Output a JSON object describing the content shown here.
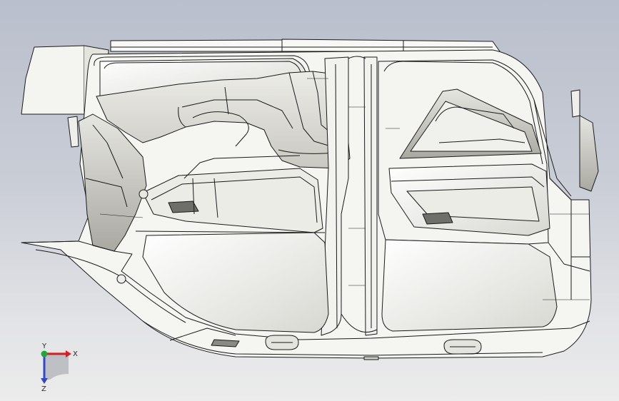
{
  "viewport": {
    "background_top": "#b9bfcc",
    "background_bottom": "#ececec"
  },
  "model": {
    "fill_light": "#f7f7f4",
    "fill_shade": "#dcdcd6",
    "fill_dark": "#b5b5ae",
    "edge_color": "#1a1a1a"
  },
  "triad": {
    "x_label": "X",
    "y_label": "Y",
    "z_label": "Z",
    "x_color": "#d42020",
    "y_color": "#1fa838",
    "z_color": "#2f49c8"
  }
}
